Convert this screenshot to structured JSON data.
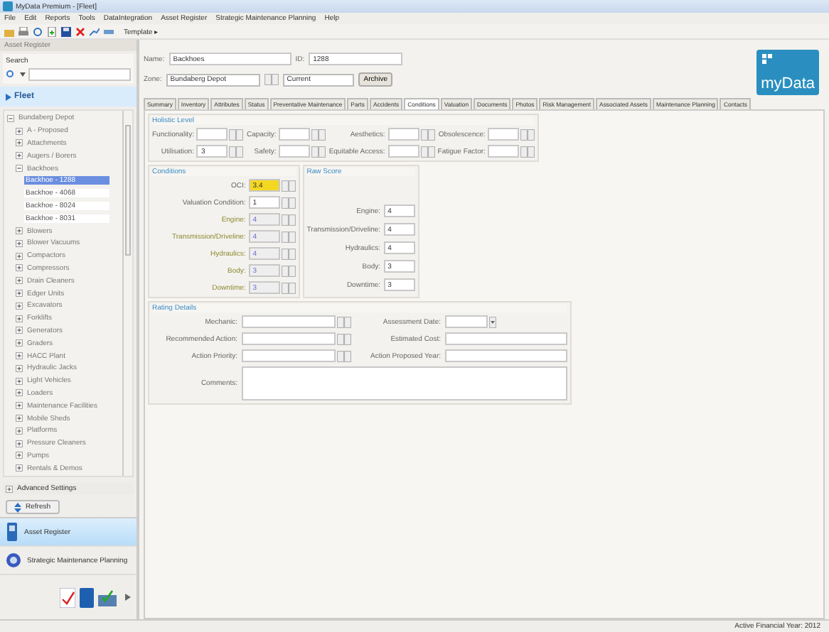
{
  "window": {
    "title": "MyData Premium - [Fleet]"
  },
  "menu": [
    "File",
    "Edit",
    "Reports",
    "Tools",
    "DataIntegration",
    "Asset Register",
    "Strategic Maintenance Planning",
    "Help"
  ],
  "toolbar": {
    "template": "Template ▸"
  },
  "sidebar": {
    "header": "Asset Register",
    "search_label": "Search",
    "section": "Fleet",
    "tree": [
      {
        "label": "Bundaberg Depot",
        "expanded": true,
        "children": [
          {
            "label": "A - Proposed",
            "expanded": false
          },
          {
            "label": "Attachments",
            "expanded": false
          },
          {
            "label": "Augers / Borers",
            "expanded": false
          },
          {
            "label": "Backhoes",
            "expanded": true,
            "children": [
              {
                "label": "Backhoe - 1288",
                "selected": true
              },
              {
                "label": "Backhoe - 4068",
                "selected": false
              },
              {
                "label": "Backhoe - 8024",
                "selected": false
              },
              {
                "label": "Backhoe - 8031",
                "selected": false
              }
            ]
          },
          {
            "label": "Blowers",
            "expanded": false
          },
          {
            "label": "Blower Vacuums",
            "expanded": false
          },
          {
            "label": "Compactors",
            "expanded": false
          },
          {
            "label": "Compressors",
            "expanded": false
          },
          {
            "label": "Drain Cleaners",
            "expanded": false
          },
          {
            "label": "Edger Units",
            "expanded": false
          },
          {
            "label": "Excavators",
            "expanded": false
          },
          {
            "label": "Forklifts",
            "expanded": false
          },
          {
            "label": "Generators",
            "expanded": false
          },
          {
            "label": "Graders",
            "expanded": false
          },
          {
            "label": "HACC Plant",
            "expanded": false
          },
          {
            "label": "Hydraulic Jacks",
            "expanded": false
          },
          {
            "label": "Light Vehicles",
            "expanded": false
          },
          {
            "label": "Loaders",
            "expanded": false
          },
          {
            "label": "Maintenance Facilities",
            "expanded": false
          },
          {
            "label": "Mobile Sheds",
            "expanded": false
          },
          {
            "label": "Platforms",
            "expanded": false
          },
          {
            "label": "Pressure Cleaners",
            "expanded": false
          },
          {
            "label": "Pumps",
            "expanded": false
          },
          {
            "label": "Rentals & Demos",
            "expanded": false
          }
        ]
      }
    ],
    "advanced": "Advanced Settings",
    "refresh": "Refresh",
    "nav": [
      {
        "label": "Asset Register",
        "selected": true
      },
      {
        "label": "Strategic Maintenance Planning",
        "selected": false
      }
    ]
  },
  "form": {
    "name_label": "Name:",
    "name": "Backhoes",
    "id_label": "ID:",
    "id": "1288",
    "zone_label": "Zone:",
    "zone": "Bundaberg Depot",
    "status": "Current",
    "archive": "Archive"
  },
  "logo": "myData",
  "tabs": [
    {
      "label": "Summary",
      "selected": false
    },
    {
      "label": "Inventory",
      "selected": false
    },
    {
      "label": "Attributes",
      "selected": false
    },
    {
      "label": "Status",
      "selected": false
    },
    {
      "label": "Preventative Maintenance",
      "selected": false
    },
    {
      "label": "Parts",
      "selected": false
    },
    {
      "label": "Accidents",
      "selected": false
    },
    {
      "label": "Conditions",
      "selected": true
    },
    {
      "label": "Valuation",
      "selected": false
    },
    {
      "label": "Documents",
      "selected": false
    },
    {
      "label": "Photos",
      "selected": false
    },
    {
      "label": "Risk Management",
      "selected": false
    },
    {
      "label": "Associated Assets",
      "selected": false
    },
    {
      "label": "Maintenance Planning",
      "selected": false
    },
    {
      "label": "Contacts",
      "selected": false
    }
  ],
  "holistic": {
    "title": "Holistic Level",
    "fields": [
      {
        "label": "Functionality:"
      },
      {
        "label": "Capacity:"
      },
      {
        "label": "Aesthetics:"
      },
      {
        "label": "Obsolescence:"
      },
      {
        "label": "Utilisation:",
        "value": "3"
      },
      {
        "label": "Safety:"
      },
      {
        "label": "Equitable Access:"
      },
      {
        "label": "Fatigue Factor:"
      }
    ]
  },
  "conditions": {
    "title": "Conditions",
    "fields": [
      {
        "label": "OCI:",
        "value": "3.4",
        "highlighted": true,
        "disabled": false
      },
      {
        "label": "Valuation Condition:",
        "value": "1",
        "highlighted": false,
        "disabled": false
      },
      {
        "label": "Engine:",
        "value": "4",
        "highlighted": false,
        "disabled": true
      },
      {
        "label": "Transmission/Driveline:",
        "value": "4",
        "highlighted": false,
        "disabled": true
      },
      {
        "label": "Hydraulics:",
        "value": "4",
        "highlighted": false,
        "disabled": true
      },
      {
        "label": "Body:",
        "value": "3",
        "highlighted": false,
        "disabled": true
      },
      {
        "label": "Downtime:",
        "value": "3",
        "highlighted": false,
        "disabled": true
      }
    ]
  },
  "raw_score": {
    "title": "Raw Score",
    "fields": [
      {
        "label": "Engine:",
        "value": "4"
      },
      {
        "label": "Transmission/Driveline:",
        "value": "4"
      },
      {
        "label": "Hydraulics:",
        "value": "4"
      },
      {
        "label": "Body:",
        "value": "3"
      },
      {
        "label": "Downtime:",
        "value": "3"
      }
    ]
  },
  "rating": {
    "title": "Rating Details",
    "fields": [
      {
        "label": "Mechanic:",
        "kind": "combo"
      },
      {
        "label": "Assessment Date:",
        "kind": "date"
      },
      {
        "label": "Recommended Action:",
        "kind": "combo"
      },
      {
        "label": "Estimated Cost:",
        "kind": "text"
      },
      {
        "label": "Action Priority:",
        "kind": "combo"
      },
      {
        "label": "Action Proposed Year:",
        "kind": "text"
      }
    ],
    "comments_label": "Comments:"
  },
  "status_bar": "Active Financial Year: 2012"
}
